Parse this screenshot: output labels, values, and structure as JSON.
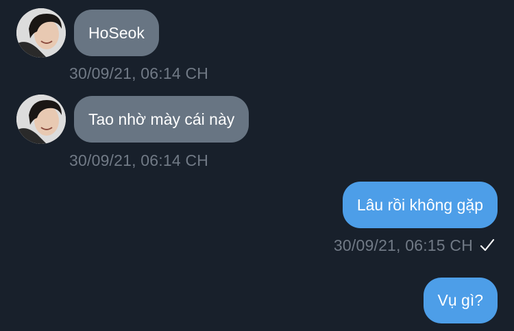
{
  "messages": [
    {
      "direction": "incoming",
      "text": "HoSeok",
      "time": "30/09/21, 06:14 CH"
    },
    {
      "direction": "incoming",
      "text": "Tao nhờ mày cái này",
      "time": "30/09/21, 06:14 CH"
    },
    {
      "direction": "outgoing",
      "text": "Lâu rồi không gặp",
      "time": "30/09/21, 06:15 CH",
      "status_icon": "checkmark-icon"
    },
    {
      "direction": "outgoing",
      "text": "Vụ gì?"
    }
  ],
  "colors": {
    "background": "#18202b",
    "incoming_bubble": "#687583",
    "outgoing_bubble": "#4d9ee8",
    "timestamp": "#717a86"
  }
}
